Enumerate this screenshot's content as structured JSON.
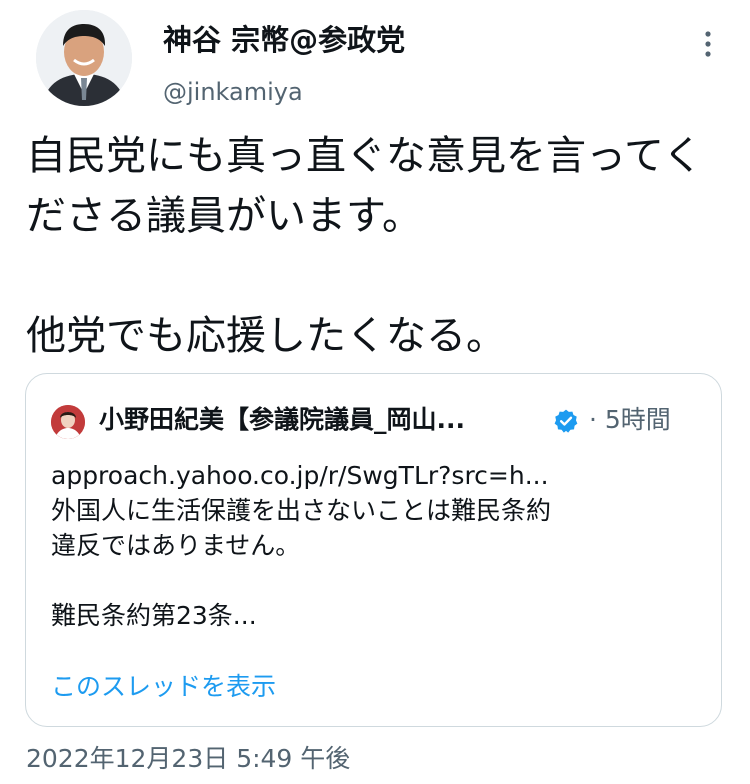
{
  "author": {
    "display_name": "神谷 宗幣@参政党",
    "handle": "@jinkamiya"
  },
  "tweet": {
    "text": "自民党にも真っ直ぐな意見を言ってくださる議員がいます。\n\n他党でも応援したくなる。",
    "timestamp": "2022年12月23日 5:49 午後"
  },
  "quote": {
    "author_name": "小野田紀美【参議院議員_岡山...",
    "time": "· 5時間",
    "lines": [
      "approach.yahoo.co.jp/r/SwgTLr?src=h...",
      "外国人に生活保護を出さないことは難民条約",
      "違反ではありません。",
      "",
      "難民条約第23条..."
    ],
    "show_thread_label": "このスレッドを表示"
  },
  "colors": {
    "text_primary": "#0f1419",
    "text_secondary": "#536471",
    "link": "#1d9bf0",
    "border": "#cfd9de",
    "verified": "#1d9bf0"
  },
  "icons": {
    "more": "more-vertical-icon",
    "verified": "verified-badge-icon"
  }
}
